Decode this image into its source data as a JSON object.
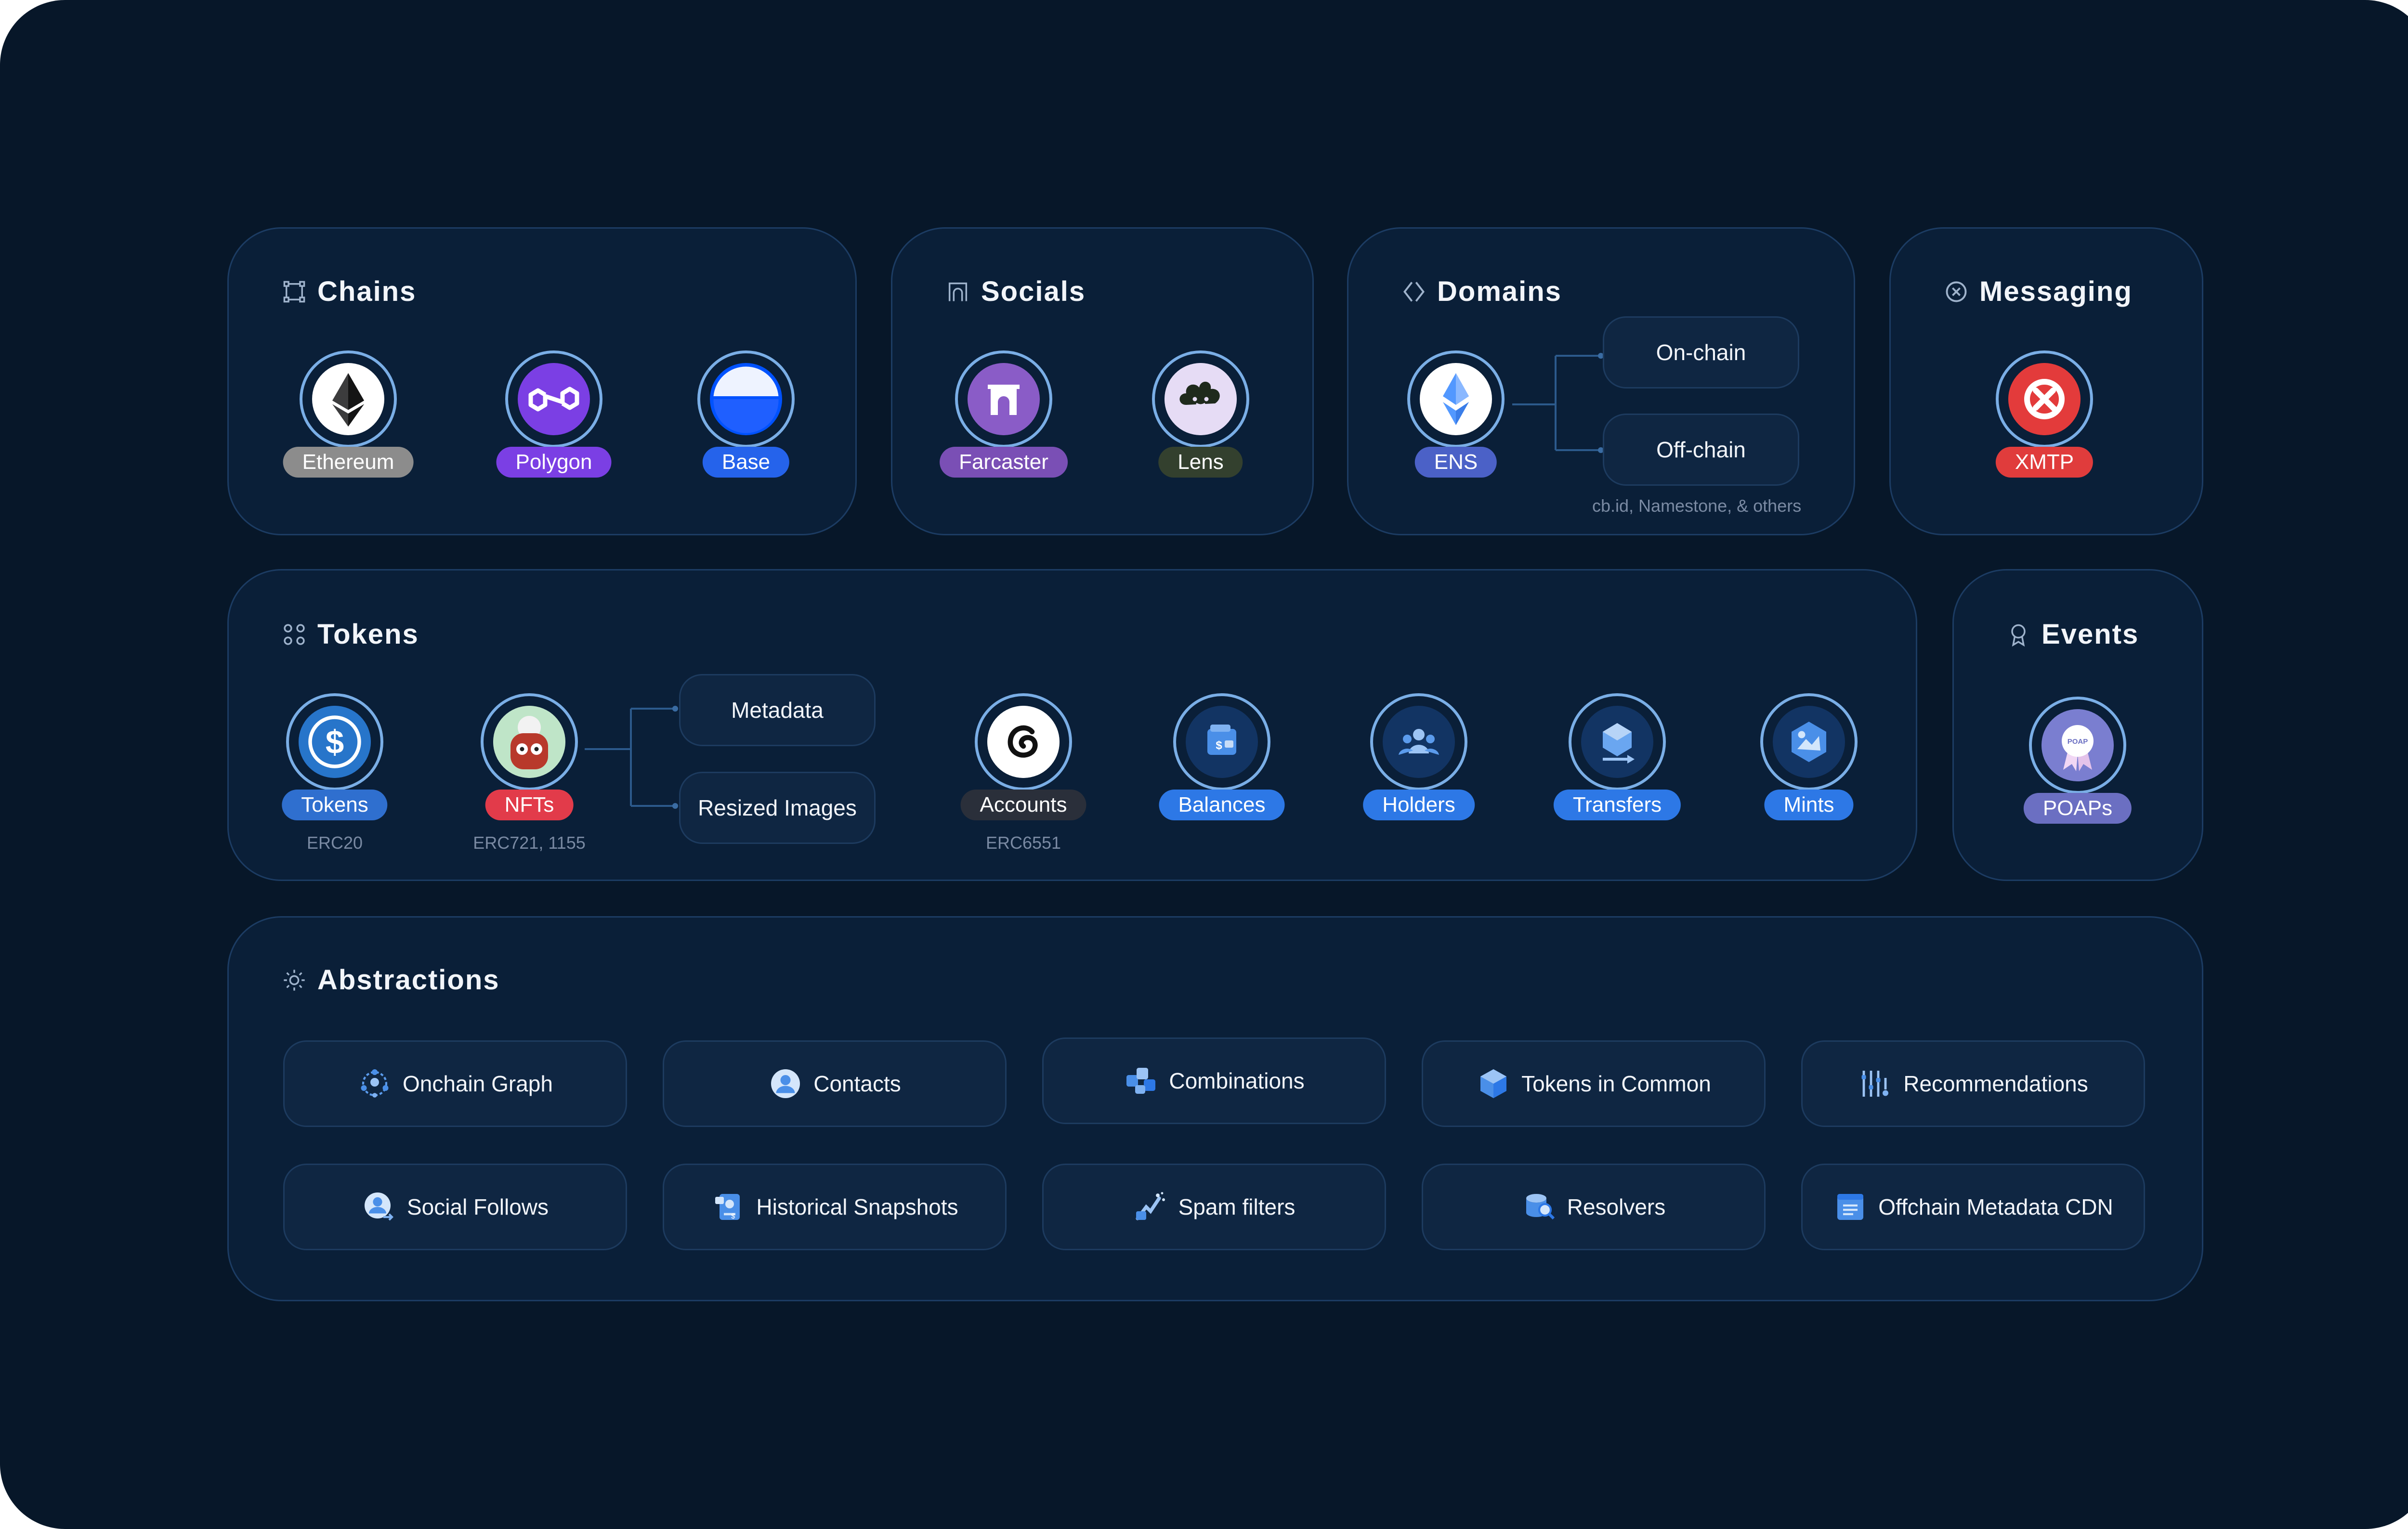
{
  "chains": {
    "title": "Chains",
    "items": [
      {
        "label": "Ethereum",
        "color": "#8c8c8c"
      },
      {
        "label": "Polygon",
        "color": "#7b3fe4"
      },
      {
        "label": "Base",
        "color": "#2563eb"
      }
    ]
  },
  "socials": {
    "title": "Socials",
    "items": [
      {
        "label": "Farcaster",
        "color": "#7a4fb5"
      },
      {
        "label": "Lens",
        "color": "#33402e"
      }
    ]
  },
  "domains": {
    "title": "Domains",
    "ens": {
      "label": "ENS",
      "color": "#4b61c7"
    },
    "onchain": "On-chain",
    "offchain": "Off-chain",
    "offchain_note": "cb.id, Namestone, & others"
  },
  "messaging": {
    "title": "Messaging",
    "item": {
      "label": "XMTP",
      "color": "#e03c3c"
    }
  },
  "tokens": {
    "title": "Tokens",
    "items": [
      {
        "label": "Tokens",
        "sub": "ERC20",
        "color": "#2f6fcf"
      },
      {
        "label": "NFTs",
        "sub": "ERC721, 1155",
        "color": "#e23b4a"
      },
      {
        "label": "Accounts",
        "sub": "ERC6551",
        "color": "#2a2f3a"
      },
      {
        "label": "Balances",
        "sub": "",
        "color": "#2d78e6"
      },
      {
        "label": "Holders",
        "sub": "",
        "color": "#2d78e6"
      },
      {
        "label": "Transfers",
        "sub": "",
        "color": "#2d78e6"
      },
      {
        "label": "Mints",
        "sub": "",
        "color": "#2d78e6"
      }
    ],
    "metadata": "Metadata",
    "resized": "Resized Images"
  },
  "events": {
    "title": "Events",
    "item": {
      "label": "POAPs",
      "color": "#6b6fc2"
    }
  },
  "abstractions": {
    "title": "Abstractions",
    "items": [
      {
        "label": "Onchain Graph",
        "icon": "graph-icon"
      },
      {
        "label": "Contacts",
        "icon": "contacts-icon"
      },
      {
        "label": "Combinations",
        "icon": "combinations-icon"
      },
      {
        "label": "Tokens in Common",
        "icon": "cube-icon"
      },
      {
        "label": "Recommendations",
        "icon": "sliders-icon"
      },
      {
        "label": "Social Follows",
        "icon": "follow-icon"
      },
      {
        "label": "Historical Snapshots",
        "icon": "snapshot-icon"
      },
      {
        "label": "Spam filters",
        "icon": "spam-filter-icon"
      },
      {
        "label": "Resolvers",
        "icon": "resolver-icon"
      },
      {
        "label": "Offchain Metadata CDN",
        "icon": "document-icon"
      }
    ]
  }
}
